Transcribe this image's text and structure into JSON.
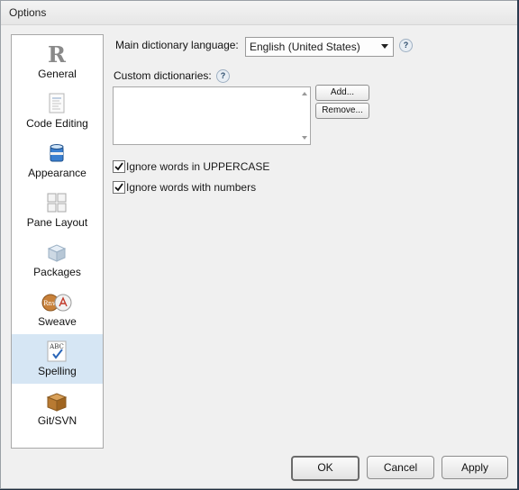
{
  "window": {
    "title": "Options"
  },
  "sidebar": {
    "items": [
      {
        "label": "General",
        "icon": "r-logo-icon",
        "selected": false
      },
      {
        "label": "Code Editing",
        "icon": "code-document-icon",
        "selected": false
      },
      {
        "label": "Appearance",
        "icon": "paint-bucket-icon",
        "selected": false
      },
      {
        "label": "Pane Layout",
        "icon": "pane-grid-icon",
        "selected": false
      },
      {
        "label": "Packages",
        "icon": "package-box-icon",
        "selected": false
      },
      {
        "label": "Sweave",
        "icon": "sweave-pdf-icon",
        "selected": false
      },
      {
        "label": "Spelling",
        "icon": "abc-check-icon",
        "selected": true
      },
      {
        "label": "Git/SVN",
        "icon": "git-box-icon",
        "selected": false
      }
    ]
  },
  "spelling": {
    "main_dictionary_label": "Main dictionary language:",
    "main_dictionary_value": "English (United States)",
    "help_symbol": "?",
    "custom_dictionaries_label": "Custom dictionaries:",
    "add_label": "Add...",
    "remove_label": "Remove...",
    "ignore_uppercase_label": "Ignore words in UPPERCASE",
    "ignore_uppercase_checked": true,
    "ignore_numbers_label": "Ignore words with numbers",
    "ignore_numbers_checked": true
  },
  "footer": {
    "ok_label": "OK",
    "cancel_label": "Cancel",
    "apply_label": "Apply"
  },
  "colors": {
    "selected_item_bg": "#d6e6f4",
    "dialog_bg": "#f0f0f0"
  }
}
